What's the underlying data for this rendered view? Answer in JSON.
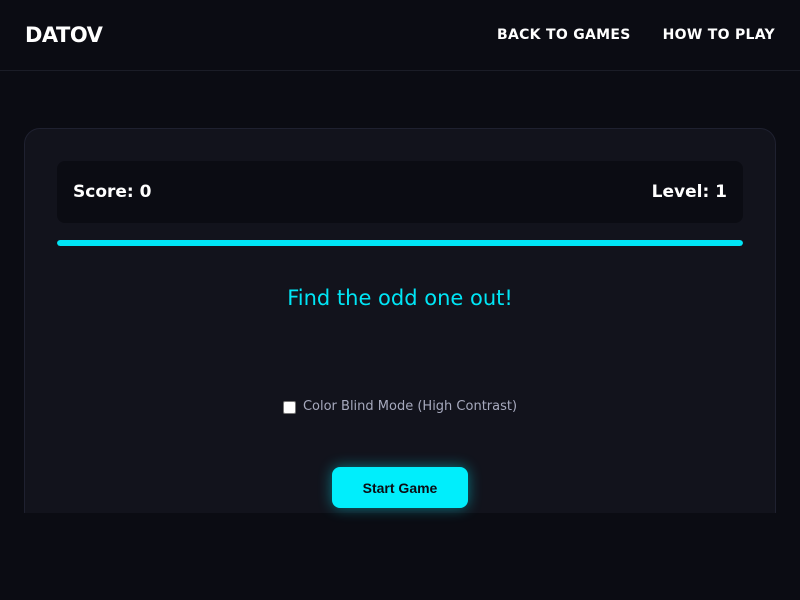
{
  "header": {
    "logo": "DATOV",
    "nav": [
      {
        "label": "BACK TO GAMES"
      },
      {
        "label": "HOW TO PLAY"
      }
    ]
  },
  "game": {
    "score_text": "Score: 0",
    "level_text": "Level: 1",
    "progress": 1.0,
    "prompt": "Find the odd one out!",
    "color_blind_label": "Color Blind Mode (High Contrast)",
    "color_blind_checked": false,
    "start_label": "Start Game"
  },
  "colors": {
    "background": "#0b0c13",
    "card": "#12131c",
    "accent": "#00e5f5",
    "button": "#00eefc",
    "text": "#ffffff",
    "muted_text": "#a6a9bd"
  },
  "icons": {
    "checkbox": "checkbox-unchecked"
  }
}
